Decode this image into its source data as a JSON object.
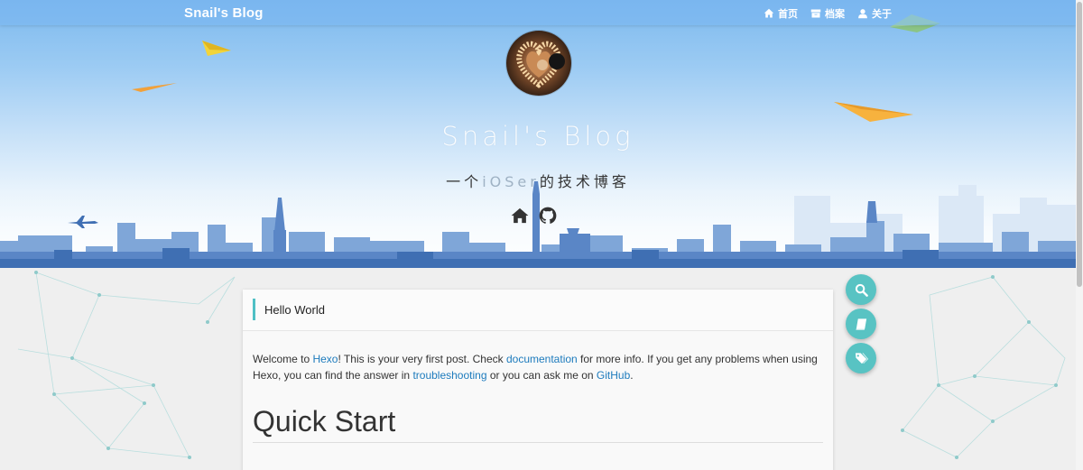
{
  "nav": {
    "brand": "Snail's Blog",
    "links": [
      {
        "label": "首页",
        "icon": "home-icon"
      },
      {
        "label": "档案",
        "icon": "archive-icon"
      },
      {
        "label": "关于",
        "icon": "user-icon"
      }
    ]
  },
  "header": {
    "title": "Snail's Blog",
    "subtitle_prefix": "一个",
    "subtitle_highlight": "iOSer",
    "subtitle_suffix": "的技术博客",
    "social": [
      "home-icon",
      "github-icon"
    ]
  },
  "post": {
    "title": "Hello World",
    "p1": "Welcome to ",
    "link_hexo": "Hexo",
    "p2": "! This is your very first post. Check ",
    "link_docs": "documentation",
    "p3": " for more info. If you get any problems when using Hexo, you can find the answer in ",
    "link_trouble": "troubleshooting",
    "p4": " or you can ask me on ",
    "link_github": "GitHub",
    "p5": ".",
    "heading": "Quick Start"
  },
  "fabs": [
    "search-icon",
    "book-icon",
    "tags-icon"
  ],
  "colors": {
    "accent": "#58c3c3",
    "link": "#1d7bbd",
    "skyline": "#4a7ec0"
  }
}
